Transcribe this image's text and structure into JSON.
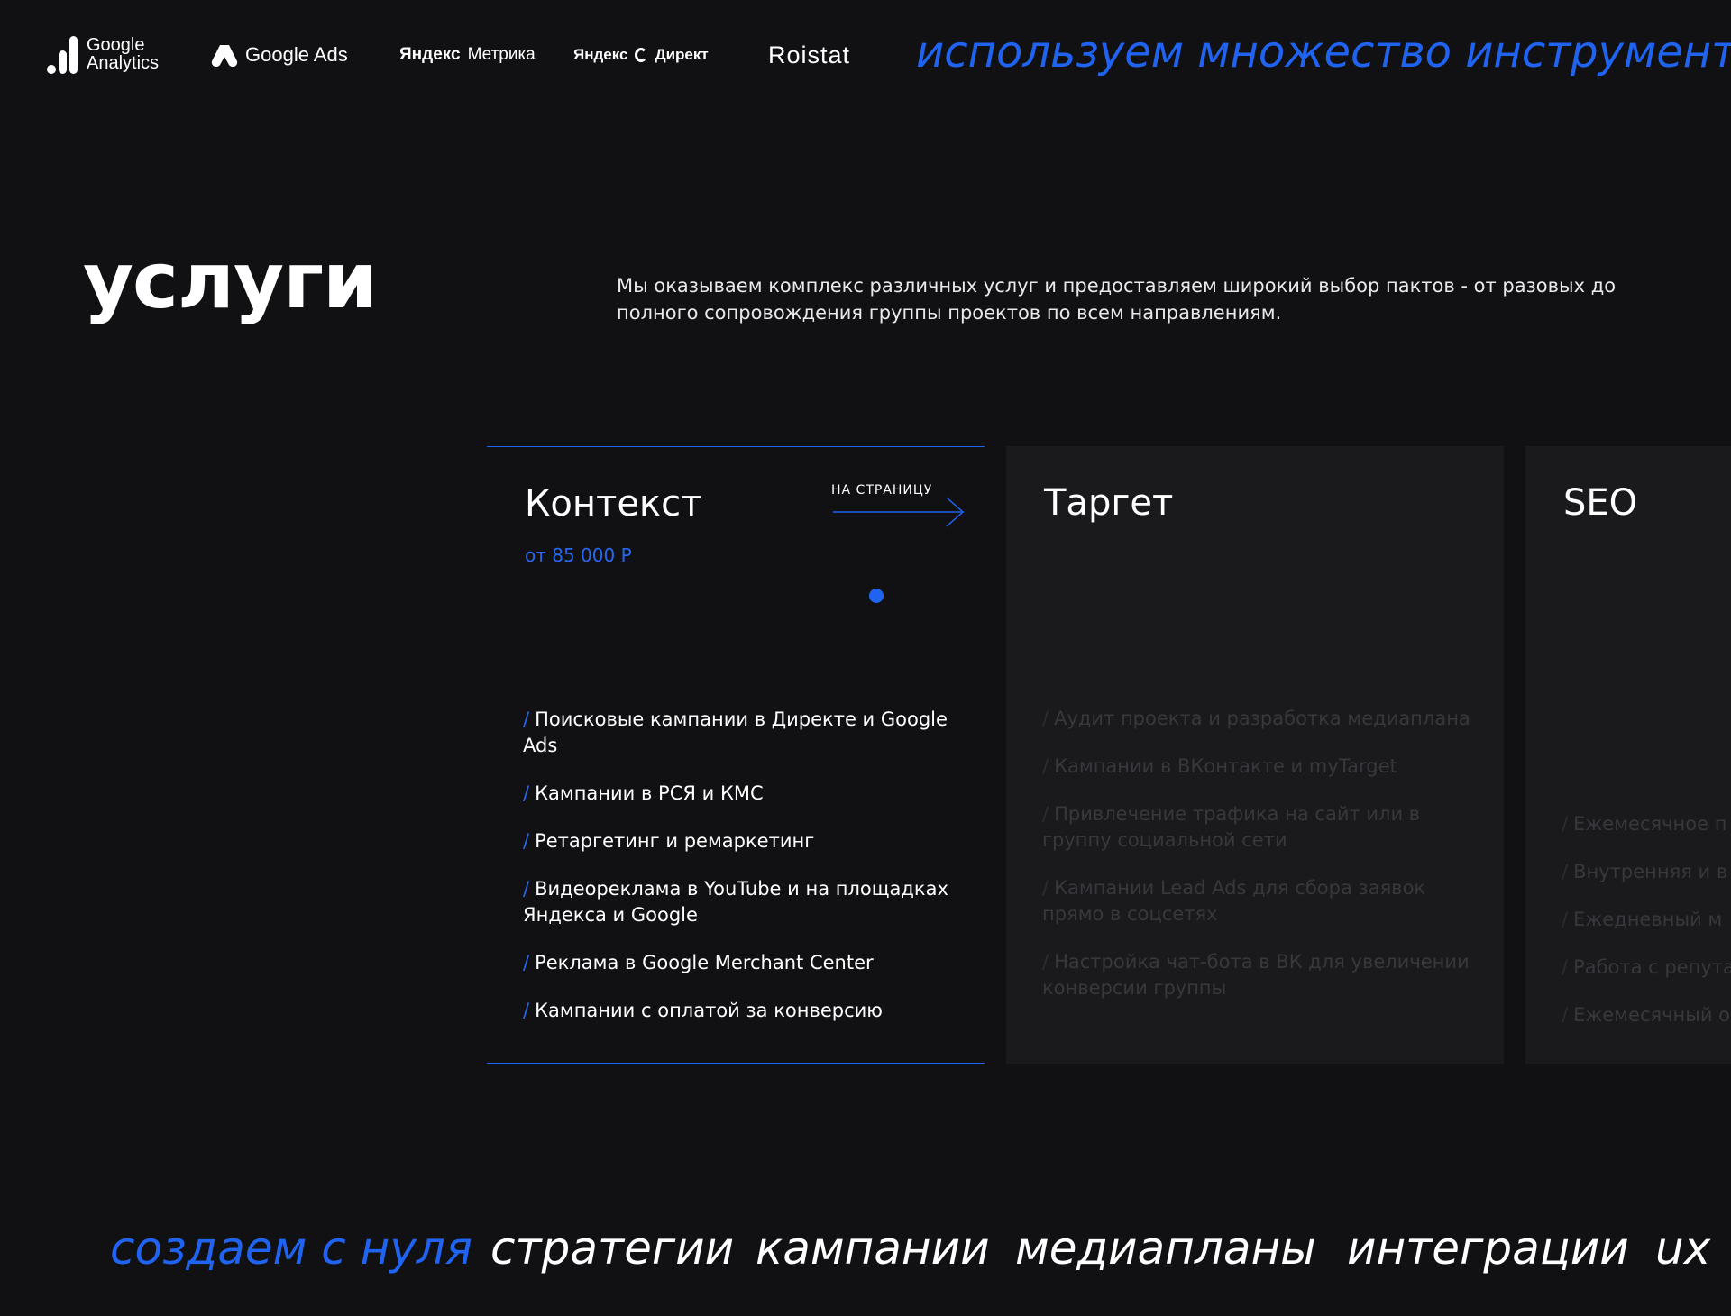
{
  "tools": {
    "google_analytics": {
      "line1": "Google",
      "line2": "Analytics"
    },
    "google_ads": "Google Ads",
    "yandex_metrika": {
      "brand": "Яндекс",
      "product": "Метрика"
    },
    "yandex_direct": {
      "brand": "Яндекс",
      "product": "Директ"
    },
    "roistat": "Roistat",
    "tagline": "используем множество инструментов"
  },
  "services": {
    "title": "услуги",
    "description": "Мы оказываем комплекс различных услуг и предоставляем широкий выбор пактов - от разовых до полного сопровождения группы проектов по всем направлениям."
  },
  "cards": [
    {
      "title": "Контекст",
      "price": "от 85 000 Р",
      "link_label": "НА СТРАНИЦУ",
      "items": [
        "Поисковые кампании в Директе и Google Ads",
        "Кампании в РСЯ и КМС",
        "Ретаргетинг и ремаркетинг",
        "Видеореклама в YouTube и на площадках Яндекса и Google",
        "Реклама в Google Merchant Center",
        "Кампании с оплатой за конверсию"
      ]
    },
    {
      "title": "Таргет",
      "items": [
        "Аудит проекта и разработка медиаплана",
        "Кампании в ВКонтакте и myTarget",
        "Привлечение трафика на сайт или в группу социальной сети",
        "Кампании Lead Ads для сбора заявок прямо в соцсетях",
        "Настройка чат-бота в ВК для увеличении конверсии группы"
      ]
    },
    {
      "title": "SEO",
      "items": [
        "Ежемесячное п",
        "Внутренняя и в",
        "Ежедневный м",
        "Работа с репута",
        "Ежемесячный о"
      ]
    }
  ],
  "ticker": [
    "создаем с нуля",
    "стратегии",
    "кампании",
    "медиапланы",
    "интеграции",
    "ux"
  ],
  "colors": {
    "background": "#111113",
    "accent": "#1f63f0",
    "card_inactive": "#1a1a1d"
  },
  "icons": {
    "arrow": "arrow-right-icon",
    "slash": "slash-bullet"
  }
}
